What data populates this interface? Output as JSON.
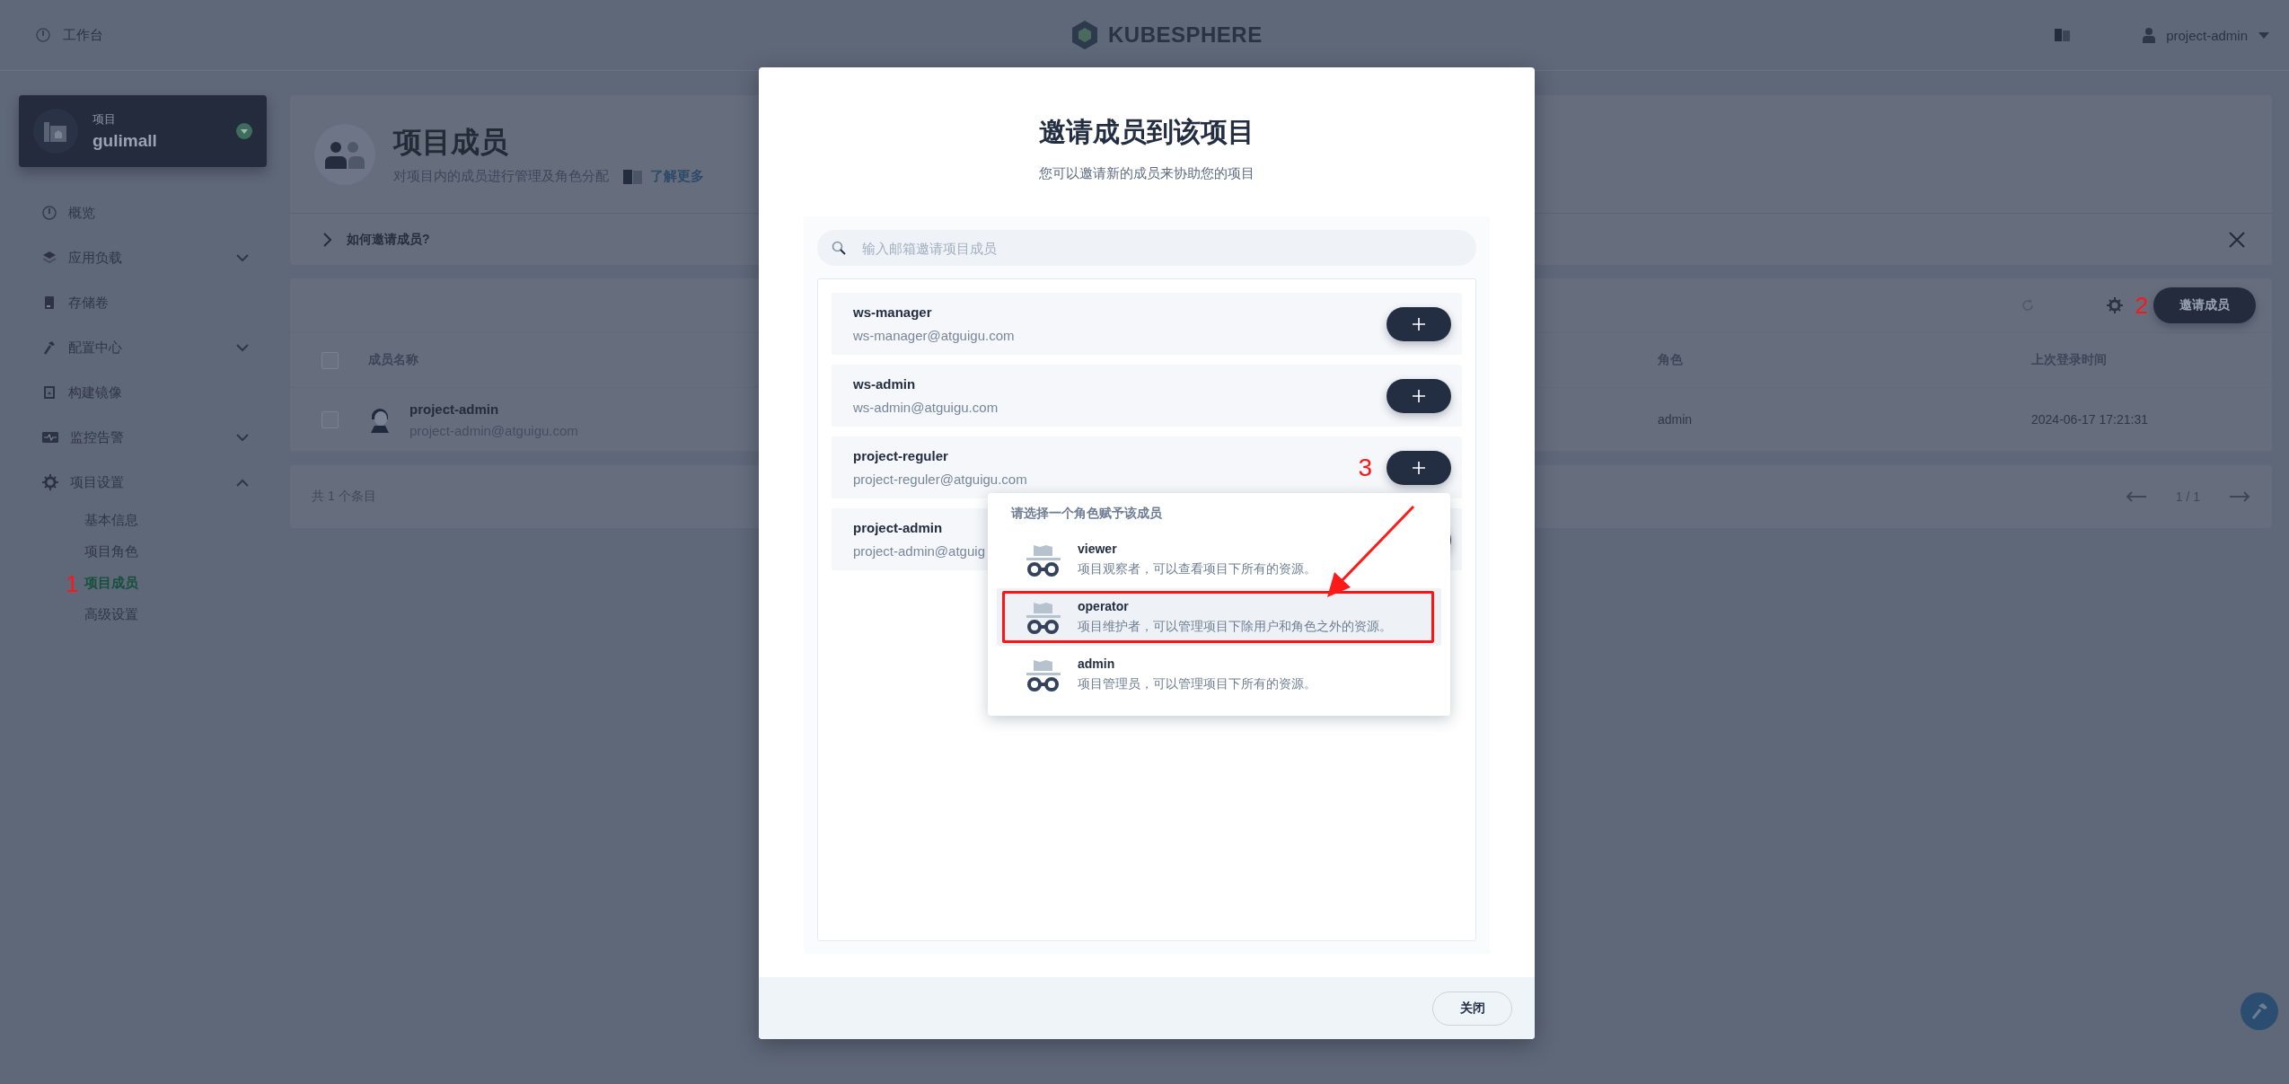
{
  "top_bar": {
    "workbench": "工作台",
    "logo": "KUBESPHERE",
    "user": "project-admin"
  },
  "project": {
    "type_label": "项目",
    "name": "gulimall"
  },
  "nav": [
    {
      "label": "概览",
      "kind": "link"
    },
    {
      "label": "应用负载",
      "kind": "group",
      "expanded": false
    },
    {
      "label": "存储卷",
      "kind": "link"
    },
    {
      "label": "配置中心",
      "kind": "group",
      "expanded": false
    },
    {
      "label": "构建镜像",
      "kind": "link"
    },
    {
      "label": "监控告警",
      "kind": "group",
      "expanded": false
    },
    {
      "label": "项目设置",
      "kind": "group",
      "expanded": true,
      "children": [
        {
          "label": "基本信息",
          "selected": false
        },
        {
          "label": "项目角色",
          "selected": false
        },
        {
          "label": "项目成员",
          "selected": true,
          "annotation": "1"
        },
        {
          "label": "高级设置",
          "selected": false
        }
      ]
    }
  ],
  "page": {
    "title": "项目成员",
    "description": "对项目内的成员进行管理及角色分配",
    "learn_more": "了解更多",
    "help_banner": "如何邀请成员?"
  },
  "table": {
    "invite_button": "邀请成员",
    "invite_annotation": "2",
    "select_all_checked": false,
    "columns": [
      "成员名称",
      "角色",
      "上次登录时间"
    ],
    "rows": [
      {
        "checked": false,
        "name": "project-admin",
        "email": "project-admin@atguigu.com",
        "role": "admin",
        "last_login": "2024-06-17 17:21:31"
      }
    ],
    "total": "共 1 个条目",
    "pagination": "1 / 1"
  },
  "modal": {
    "title": "邀请成员到该项目",
    "subtitle": "您可以邀请新的成员来协助您的项目",
    "search": {
      "placeholder": "输入邮箱邀请项目成员"
    },
    "users": [
      {
        "name": "ws-manager",
        "email": "ws-manager@atguigu.com",
        "covered": false
      },
      {
        "name": "ws-admin",
        "email": "ws-admin@atguigu.com",
        "covered": false
      },
      {
        "name": "project-reguler",
        "email": "project-reguler@atguigu.com",
        "annotation": "3",
        "covered": false
      },
      {
        "name": "project-admin",
        "email": "project-admin@atguig",
        "covered": true
      }
    ],
    "role_menu": {
      "title": "请选择一个角色赋予该成员",
      "arrow": true,
      "roles": [
        {
          "name": "viewer",
          "description": "项目观察者，可以查看项目下所有的资源。",
          "selected": false,
          "outlined": false
        },
        {
          "name": "operator",
          "description": "项目维护者，可以管理项目下除用户和角色之外的资源。",
          "selected": true,
          "outlined": true
        },
        {
          "name": "admin",
          "description": "项目管理员，可以管理项目下所有的资源。",
          "selected": false,
          "outlined": false
        }
      ]
    },
    "close_button": "关闭"
  }
}
